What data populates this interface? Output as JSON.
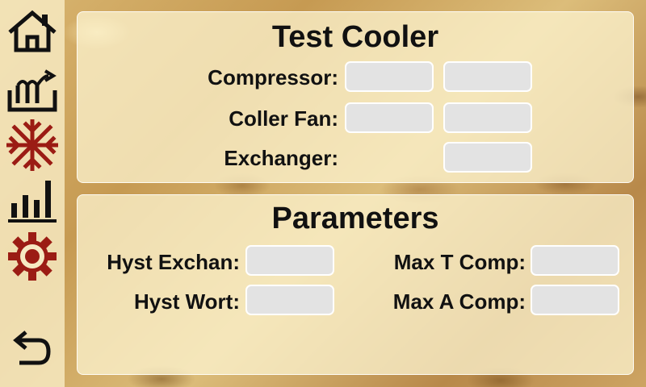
{
  "sidebar": {
    "items": [
      {
        "icon": "home-icon"
      },
      {
        "icon": "process-icon"
      },
      {
        "icon": "snowflake-icon"
      },
      {
        "icon": "bar-chart-icon"
      },
      {
        "icon": "gear-icon"
      }
    ],
    "back_icon": "back-arrow-icon",
    "colors": {
      "dark": "#111111",
      "accent": "#9b1c14"
    }
  },
  "test_cooler": {
    "title": "Test Cooler",
    "compressor_label": "Compressor:",
    "fan_label": "Coller Fan:",
    "exchanger_label": "Exchanger:",
    "compressor_value_1": "",
    "compressor_value_2": "",
    "fan_value_1": "",
    "fan_value_2": "",
    "exchanger_value": ""
  },
  "parameters": {
    "title": "Parameters",
    "hyst_exchan_label": "Hyst Exchan:",
    "hyst_wort_label": "Hyst Wort:",
    "max_t_comp_label": "Max T Comp:",
    "max_a_comp_label": "Max A Comp:",
    "hyst_exchan_value": "",
    "hyst_wort_value": "",
    "max_t_comp_value": "",
    "max_a_comp_value": ""
  }
}
